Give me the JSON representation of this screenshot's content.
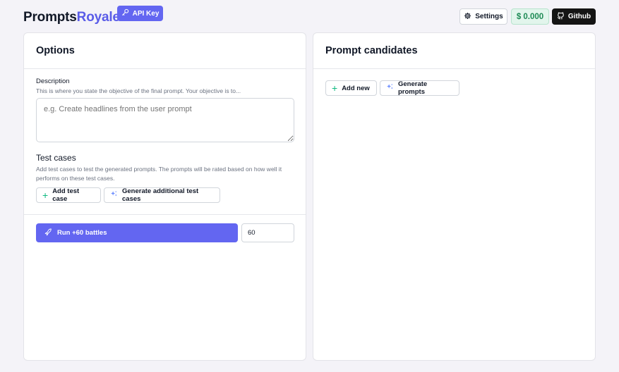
{
  "header": {
    "brand_part1": "Prompts",
    "brand_part2": "Royale",
    "api_key_label": "API Key",
    "settings_label": "Settings",
    "balance": "$ 0.000",
    "github_label": "Github"
  },
  "options": {
    "title": "Options",
    "description_label": "Description",
    "description_help": "This is where you state the objective of the final prompt. Your objective is to...",
    "description_placeholder": "e.g. Create headlines from the user prompt",
    "description_value": "",
    "test_cases_title": "Test cases",
    "test_cases_help": "Add test cases to test the generated prompts. The prompts will be rated based on how well it performs on these test cases.",
    "add_test_case_label": "Add test case",
    "generate_test_cases_label": "Generate additional test cases",
    "run_label": "Run +60 battles",
    "battles_value": "60"
  },
  "candidates": {
    "title": "Prompt candidates",
    "add_new_label": "Add new",
    "generate_prompts_label": "Generate prompts"
  },
  "colors": {
    "accent": "#6366f1",
    "brand_accent": "#5a5ce8",
    "balance_green": "#1e8a55",
    "plus_green": "#10b981",
    "background": "#f4f3f8"
  },
  "icons": [
    "key-icon",
    "gear-icon",
    "dollar-icon",
    "github-icon",
    "plus-icon",
    "sparkle-icon",
    "rocket-icon"
  ]
}
